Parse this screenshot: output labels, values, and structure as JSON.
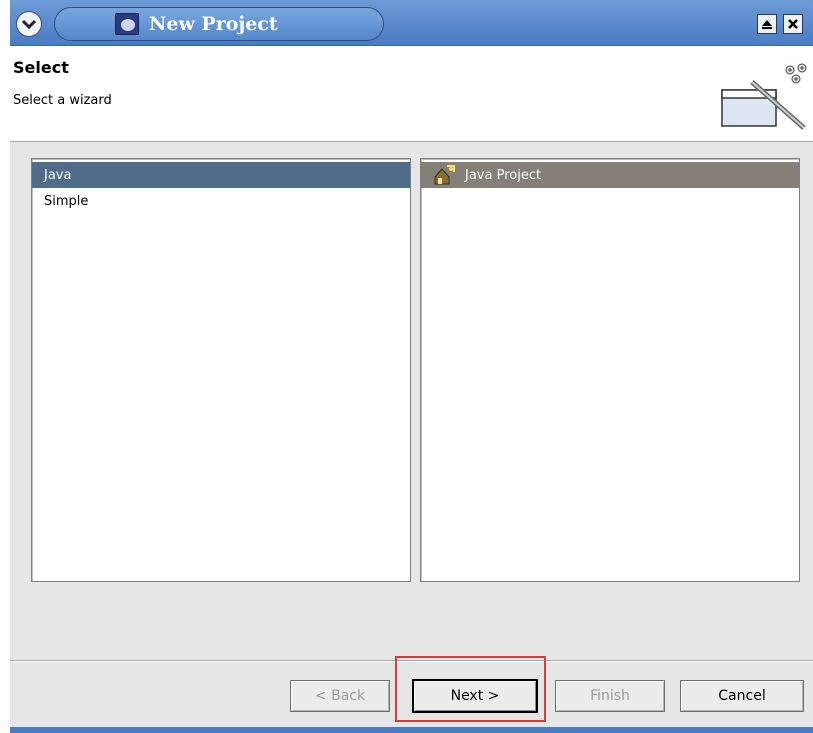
{
  "window": {
    "title": "New Project"
  },
  "header": {
    "title": "Select",
    "subtitle": "Select a wizard"
  },
  "categories": [
    {
      "label": "Java",
      "selected": true
    },
    {
      "label": "Simple",
      "selected": false
    }
  ],
  "wizards": [
    {
      "label": "Java Project",
      "selected": true,
      "icon": "java-project-icon"
    }
  ],
  "buttons": {
    "back": "< Back",
    "next": "Next >",
    "finish": "Finish",
    "cancel": "Cancel"
  },
  "colors": {
    "titlebar": "#4a7cc3",
    "selection": "#4f6c8a",
    "selection_inactive": "#858077",
    "highlight": "#d93a3a"
  }
}
